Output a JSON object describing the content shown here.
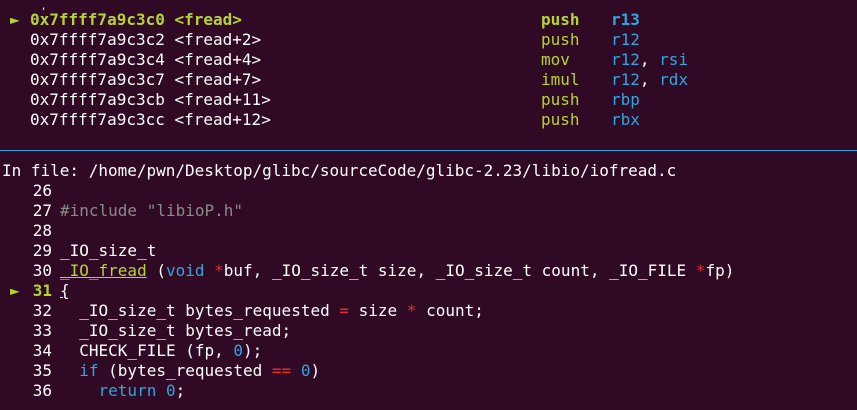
{
  "disasm": {
    "current_marker": "►",
    "down_arrow": "↓",
    "rows": [
      {
        "addr": "0x7ffff7a9c3c0 <fread>",
        "mnemonic": "push",
        "operands": [
          {
            "t": "r13"
          }
        ],
        "current": true
      },
      {
        "addr": "0x7ffff7a9c3c2 <fread+2>",
        "mnemonic": "push",
        "operands": [
          {
            "t": "r12"
          }
        ],
        "current": false
      },
      {
        "addr": "0x7ffff7a9c3c4 <fread+4>",
        "mnemonic": "mov",
        "operands": [
          {
            "t": "r12"
          },
          {
            "t": ", ",
            "sep": true
          },
          {
            "t": "rsi"
          }
        ],
        "current": false
      },
      {
        "addr": "0x7ffff7a9c3c7 <fread+7>",
        "mnemonic": "imul",
        "operands": [
          {
            "t": "r12"
          },
          {
            "t": ", ",
            "sep": true
          },
          {
            "t": "rdx"
          }
        ],
        "current": false
      },
      {
        "addr": "0x7ffff7a9c3cb <fread+11>",
        "mnemonic": "push",
        "operands": [
          {
            "t": "rbp"
          }
        ],
        "current": false
      },
      {
        "addr": "0x7ffff7a9c3cc <fread+12>",
        "mnemonic": "push",
        "operands": [
          {
            "t": "rbx"
          }
        ],
        "current": false
      }
    ]
  },
  "source": {
    "file_label": "In file: /home/pwn/Desktop/glibc/sourceCode/glibc-2.23/libio/iofread.c",
    "current_marker": "►",
    "lines": [
      {
        "n": "26",
        "current": false,
        "segs": []
      },
      {
        "n": "27",
        "current": false,
        "segs": [
          {
            "c": "gray",
            "t": "#include \"libioP.h\""
          }
        ]
      },
      {
        "n": "28",
        "current": false,
        "segs": []
      },
      {
        "n": "29",
        "current": false,
        "segs": [
          {
            "c": "",
            "t": "_IO_size_t"
          }
        ]
      },
      {
        "n": "30",
        "current": false,
        "segs": [
          {
            "c": "hl",
            "t": "_IO_fread"
          },
          {
            "c": "",
            "t": " ("
          },
          {
            "c": "blue",
            "t": "void"
          },
          {
            "c": "",
            "t": " "
          },
          {
            "c": "red",
            "t": "*"
          },
          {
            "c": "",
            "t": "buf, _IO_size_t size, _IO_size_t count, _IO_FILE "
          },
          {
            "c": "red",
            "t": "*"
          },
          {
            "c": "",
            "t": "fp)"
          }
        ]
      },
      {
        "n": "31",
        "current": true,
        "segs": [
          {
            "c": "",
            "t": "{"
          }
        ]
      },
      {
        "n": "32",
        "current": false,
        "segs": [
          {
            "c": "",
            "t": "  _IO_size_t bytes_requested "
          },
          {
            "c": "red",
            "t": "="
          },
          {
            "c": "",
            "t": " size "
          },
          {
            "c": "red",
            "t": "*"
          },
          {
            "c": "",
            "t": " count;"
          }
        ]
      },
      {
        "n": "33",
        "current": false,
        "segs": [
          {
            "c": "",
            "t": "  _IO_size_t bytes_read;"
          }
        ]
      },
      {
        "n": "34",
        "current": false,
        "segs": [
          {
            "c": "",
            "t": "  CHECK_FILE (fp, "
          },
          {
            "c": "blue",
            "t": "0"
          },
          {
            "c": "",
            "t": ");"
          }
        ]
      },
      {
        "n": "35",
        "current": false,
        "segs": [
          {
            "c": "",
            "t": "  "
          },
          {
            "c": "blue",
            "t": "if"
          },
          {
            "c": "",
            "t": " (bytes_requested "
          },
          {
            "c": "red",
            "t": "=="
          },
          {
            "c": "",
            "t": " "
          },
          {
            "c": "blue",
            "t": "0"
          },
          {
            "c": "",
            "t": ")"
          }
        ]
      },
      {
        "n": "36",
        "current": false,
        "segs": [
          {
            "c": "",
            "t": "    "
          },
          {
            "c": "blue",
            "t": "return"
          },
          {
            "c": "",
            "t": " "
          },
          {
            "c": "blue",
            "t": "0"
          },
          {
            "c": "",
            "t": ";"
          }
        ]
      }
    ]
  }
}
